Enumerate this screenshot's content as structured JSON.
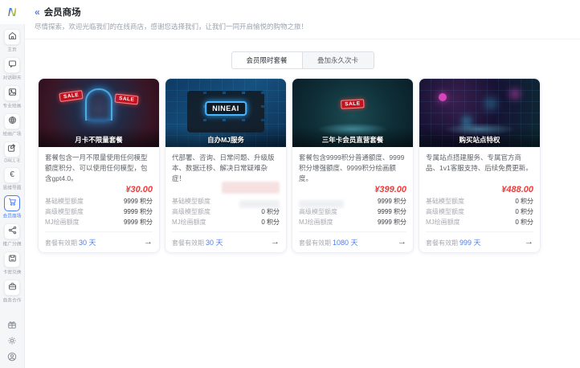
{
  "header": {
    "collapse_icon": "«",
    "title": "会员商场",
    "subtitle": "尽情探索，欢迎光临我们的在线商店，感谢您选择我们，让我们一同开启愉悦的购物之旅！"
  },
  "sidebar": {
    "logo_text": "N",
    "items": [
      {
        "label": "主页"
      },
      {
        "label": "对话聊天"
      },
      {
        "label": "专业绘画"
      },
      {
        "label": "绘画广场"
      },
      {
        "label": "DALL·E"
      },
      {
        "label": "思维导图"
      },
      {
        "label": "会员商场"
      },
      {
        "label": "推广分佣"
      },
      {
        "label": "卡密兑换"
      },
      {
        "label": "商务合作"
      }
    ]
  },
  "tabs": [
    {
      "label": "会员限时套餐"
    },
    {
      "label": "叠加永久次卡"
    }
  ],
  "card_footer": {
    "validity_label": "套餐有效期",
    "arrow": "→"
  },
  "products": [
    {
      "image_caption": "月卡不限量套餐",
      "image_badge": "SALE",
      "image_badge2": "SALE",
      "description": "套餐包含一月不限量使用任何模型额度积分、可以使用任何模型，包含gpt4.0。",
      "price": "¥30.00",
      "rows": [
        {
          "label": "基础模型额度",
          "value": "9999 积分"
        },
        {
          "label": "高级模型额度",
          "value": "9999 积分"
        },
        {
          "label": "MJ绘画额度",
          "value": "9999 积分"
        }
      ],
      "validity": "30 天"
    },
    {
      "image_caption": "自办MJ服务",
      "image_logo": "NINEAI",
      "description": "代部署、咨询、日常问题、升级版本、数据迁移、解决日常疑难杂症！",
      "price": "",
      "price_redacted": true,
      "rows": [
        {
          "label": "基础模型额度",
          "value": "",
          "value_redacted": true
        },
        {
          "label": "高级模型额度",
          "value": "0 积分"
        },
        {
          "label": "MJ绘画额度",
          "value": "0 积分"
        }
      ],
      "validity": "30 天"
    },
    {
      "image_caption": "三年卡会员直营套餐",
      "image_badge": "SALE",
      "description": "套餐包含9999积分普通额度、9999积分增强额度、9999积分绘画额度。",
      "price": "¥399.00",
      "rows": [
        {
          "label": "",
          "label_redacted": true,
          "value": "9999 积分"
        },
        {
          "label": "高级模型额度",
          "value": "9999 积分"
        },
        {
          "label": "MJ绘画额度",
          "value": "9999 积分"
        }
      ],
      "validity": "1080 天"
    },
    {
      "image_caption": "购买站点特权",
      "description": "专属站点搭建服务、专属官方商品、1v1客服支持、后续免费更新。",
      "price": "¥488.00",
      "rows": [
        {
          "label": "基础模型额度",
          "value": "0 积分"
        },
        {
          "label": "高级模型额度",
          "value": "0 积分"
        },
        {
          "label": "MJ绘画额度",
          "value": "0 积分"
        }
      ],
      "validity": "999 天"
    }
  ],
  "colors": {
    "accent": "#4a7df5",
    "price_red": "#ee3b3b"
  }
}
